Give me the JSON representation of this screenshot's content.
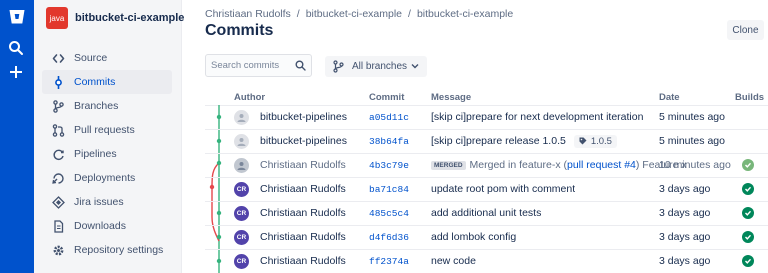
{
  "global_nav": {
    "logo_icon": "bitbucket-logo-icon",
    "search_icon": "search-icon",
    "create_icon": "plus-icon"
  },
  "repo": {
    "avatar_text": "java",
    "name": "bitbucket-ci-example"
  },
  "sidebar": {
    "items": [
      {
        "label": "Source",
        "icon": "code-icon",
        "active": false
      },
      {
        "label": "Commits",
        "icon": "commit-icon",
        "active": true
      },
      {
        "label": "Branches",
        "icon": "branch-icon",
        "active": false
      },
      {
        "label": "Pull requests",
        "icon": "pull-request-icon",
        "active": false
      },
      {
        "label": "Pipelines",
        "icon": "pipelines-icon",
        "active": false
      },
      {
        "label": "Deployments",
        "icon": "deployments-icon",
        "active": false
      },
      {
        "label": "Jira issues",
        "icon": "jira-icon",
        "active": false
      },
      {
        "label": "Downloads",
        "icon": "downloads-icon",
        "active": false
      },
      {
        "label": "Repository settings",
        "icon": "settings-icon",
        "active": false
      }
    ]
  },
  "breadcrumb": [
    "Christiaan Rudolfs",
    "bitbucket-ci-example",
    "bitbucket-ci-example"
  ],
  "page_title": "Commits",
  "clone_label": "Clone",
  "search": {
    "placeholder": "Search commits",
    "value": ""
  },
  "branch_filter": {
    "label": "All branches"
  },
  "table": {
    "headers": {
      "author": "Author",
      "commit": "Commit",
      "message": "Message",
      "date": "Date",
      "builds": "Builds"
    },
    "rows": [
      {
        "avatar": "",
        "author": "bitbucket-pipelines",
        "hash": "a05d11c",
        "message": "[skip ci]prepare for next development iteration",
        "date": "5 minutes ago",
        "build": "",
        "muted": false
      },
      {
        "avatar": "",
        "author": "bitbucket-pipelines",
        "hash": "38b64fa",
        "message": "[skip ci]prepare release 1.0.5",
        "tag": "1.0.5",
        "date": "5 minutes ago",
        "build": "",
        "muted": false
      },
      {
        "avatar": "",
        "author": "Christiaan Rudolfs",
        "hash": "4b3c79e",
        "merged_label": "MERGED",
        "message_before": "Merged in feature-x (",
        "pr_link": "pull request #4",
        "message_after": ") Feature x",
        "date": "10 minutes ago",
        "build": "success",
        "muted": true
      },
      {
        "avatar": "CR",
        "author": "Christiaan Rudolfs",
        "hash": "ba71c84",
        "message": "update root pom with comment",
        "date": "3 days ago",
        "build": "success",
        "muted": false
      },
      {
        "avatar": "CR",
        "author": "Christiaan Rudolfs",
        "hash": "485c5c4",
        "message": "add additional unit tests",
        "date": "3 days ago",
        "build": "success",
        "muted": false
      },
      {
        "avatar": "CR",
        "author": "Christiaan Rudolfs",
        "hash": "d4f6d36",
        "message": "add lombok config",
        "date": "3 days ago",
        "build": "success",
        "muted": false
      },
      {
        "avatar": "CR",
        "author": "Christiaan Rudolfs",
        "hash": "ff2374a",
        "message": "new code",
        "date": "3 days ago",
        "build": "success",
        "muted": false
      }
    ]
  },
  "colors": {
    "brand": "#0052cc",
    "repo_avatar": "#e2382d",
    "graph_main": "#36b37e",
    "graph_branch": "#e5484d",
    "build_success": "#00875a",
    "cr_avatar": "#5243aa"
  }
}
